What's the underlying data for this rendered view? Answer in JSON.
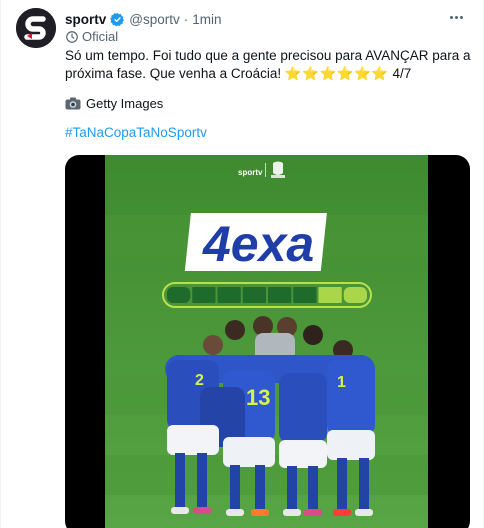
{
  "tweet": {
    "display_name": "sportv",
    "handle": "@sportv",
    "separator": "·",
    "time": "1min",
    "official_label": "Oficial",
    "text": "Só um tempo. Foi tudo que a gente precisou para AVANÇAR para a próxima fase. Que venha a Croácia!",
    "stars": "⭐⭐⭐⭐⭐⭐",
    "stars_count": "4/7",
    "credit": "Getty Images",
    "hashtag": "#TaNaCopaTaNoSportv"
  },
  "media": {
    "brand_left": "sportv",
    "headline": "4exa",
    "progress": {
      "filled": 6,
      "total": 8
    },
    "jersey_numbers": [
      "13",
      "2",
      "1"
    ]
  },
  "icons": [
    "sportv-logo",
    "verified-badge-icon",
    "official-badge-icon",
    "more-options-icon",
    "camera-icon"
  ],
  "colors": {
    "accent_blue": "#1d9bf0",
    "text_gray": "#536471",
    "pitch_green": "#4c9a3a",
    "headline_blue": "#1f3ea7"
  }
}
